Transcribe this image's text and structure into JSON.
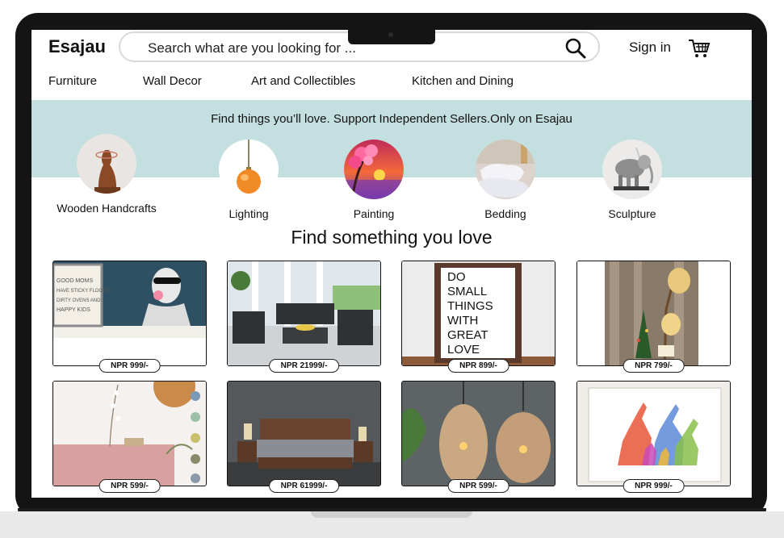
{
  "header": {
    "logo": "Esajau",
    "search_placeholder": "Search what are you  looking for ...",
    "sign_in": "Sign in"
  },
  "nav": [
    {
      "label": "Furniture"
    },
    {
      "label": "Wall Decor"
    },
    {
      "label": "Art and Collectibles"
    },
    {
      "label": "Kitchen and Dining"
    }
  ],
  "banner": {
    "text": "Find things you’ll love. Support Independent Sellers.Only on Esajau"
  },
  "categories": [
    {
      "label": "Wooden Handcrafts",
      "icon": "wooden-glasses-stand"
    },
    {
      "label": "Lighting",
      "icon": "pendant-lamp"
    },
    {
      "label": "Painting",
      "icon": "sunset-painting"
    },
    {
      "label": "Bedding",
      "icon": "pillows"
    },
    {
      "label": "Sculpture",
      "icon": "elephant-sculpture"
    }
  ],
  "section_title": "Find something you love",
  "products": [
    {
      "name": "sign-and-bust-decor",
      "price": "NPR 999/-"
    },
    {
      "name": "patio-furniture-set",
      "price": "NPR 21999/-"
    },
    {
      "name": "typography-frame",
      "price": "NPR 899/-"
    },
    {
      "name": "lantern-lamp",
      "price": "NPR 799/-"
    },
    {
      "name": "pink-tablecloth",
      "price": "NPR 599/-"
    },
    {
      "name": "wooden-bed",
      "price": "NPR 61999/-"
    },
    {
      "name": "rattan-pendant-lamps",
      "price": "NPR 599/-"
    },
    {
      "name": "giraffe-art-print",
      "price": "NPR 999/-"
    }
  ],
  "art_text": {
    "frame_words": [
      "DO",
      "SMALL",
      "THINGS",
      "WITH",
      "GREAT",
      "LOVE"
    ],
    "sign_words": [
      "GOOD MOMS",
      "HAVE STICKY FLOORS",
      "DIRTY OVENS AND",
      "HAPPY KIDS"
    ]
  },
  "colors": {
    "banner": "#c4dfdf",
    "bezel": "#141414"
  }
}
